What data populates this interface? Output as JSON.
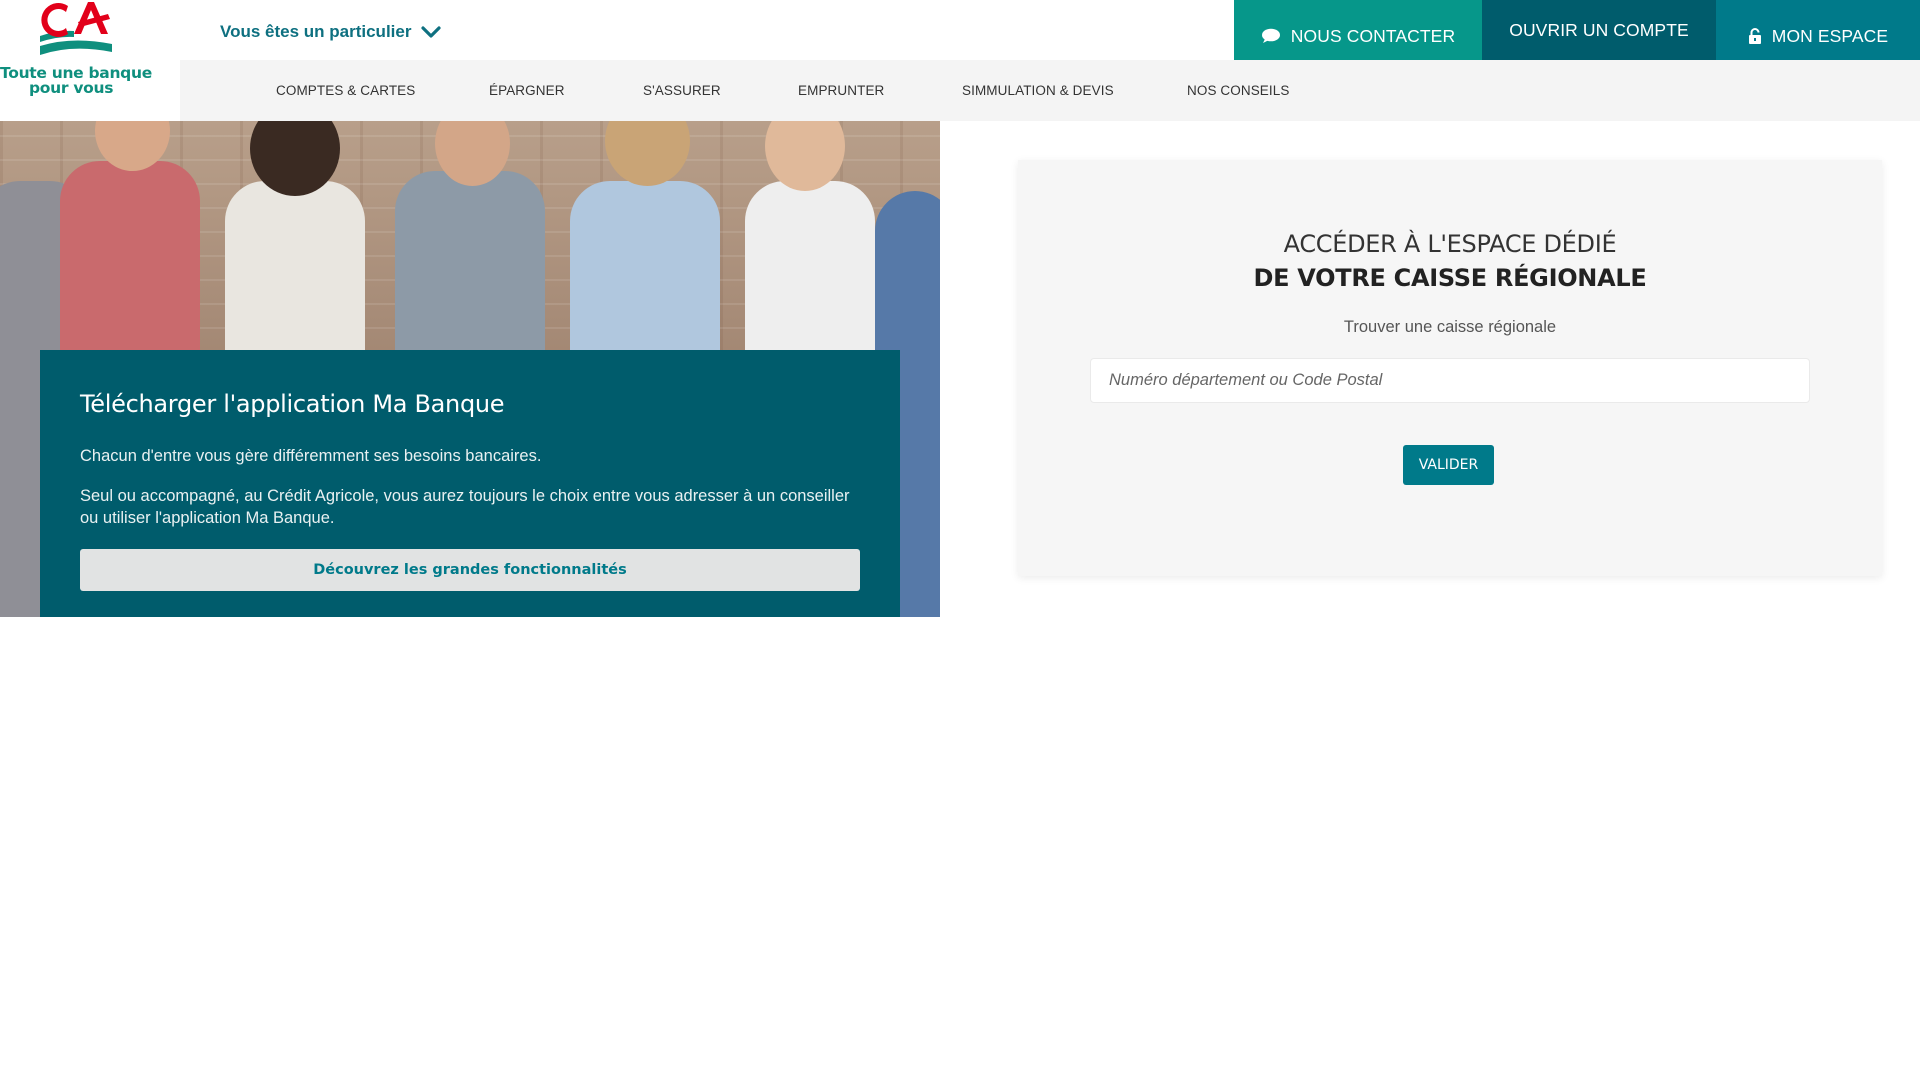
{
  "brand": {
    "tagline_line1": "Toute une banque",
    "tagline_line2": "pour vous",
    "logo_red": "#e2001a",
    "logo_green": "#0f8f7e"
  },
  "header": {
    "profile_selector": "Vous êtes un particulier",
    "buttons": {
      "contact": "NOUS CONTACTER",
      "open_account": "OUVRIR UN COMPTE",
      "my_space": "MON ESPACE"
    }
  },
  "nav": {
    "items": [
      {
        "label": "COMPTES & CARTES"
      },
      {
        "label": "ÉPARGNER"
      },
      {
        "label": "S'ASSURER"
      },
      {
        "label": "EMPRUNTER"
      },
      {
        "label": "SIMMULATION & DEVIS"
      },
      {
        "label": "NOS CONSEILS"
      }
    ]
  },
  "hero": {
    "title": "Télécharger l'application Ma Banque",
    "paragraph1": "Chacun d'entre vous gère différemment ses besoins bancaires.",
    "paragraph2": "Seul ou accompagné, au Crédit Agricole, vous aurez toujours le choix entre vous adresser à un conseiller ou utiliser l'application Ma Banque.",
    "button": "Découvrez les grandes fonctionnalités"
  },
  "regional": {
    "heading_line1": "ACCÉDER À L'ESPACE DÉDIÉ",
    "heading_line2": "DE VOTRE CAISSE RÉGIONALE",
    "subtitle": "Trouver une caisse régionale",
    "input_placeholder": "Numéro département ou Code Postal",
    "input_value": "",
    "submit": "VALIDER"
  },
  "colors": {
    "teal_dark": "#005c6c",
    "teal": "#007a8a",
    "green": "#06978a"
  }
}
